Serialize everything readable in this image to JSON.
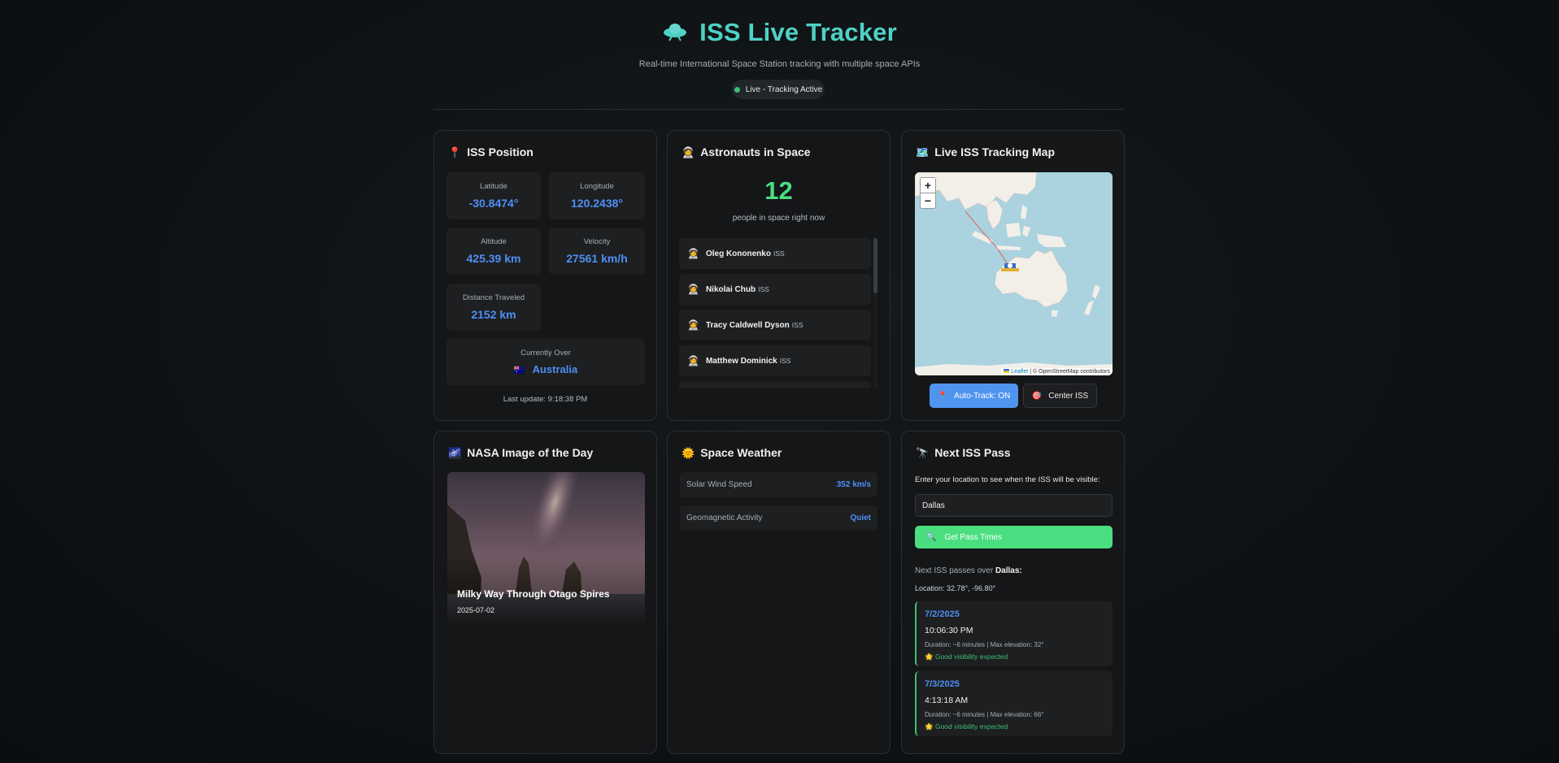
{
  "header": {
    "title": "ISS Live Tracker",
    "subtitle": "Real-time International Space Station tracking with multiple space APIs",
    "status": "Live - Tracking Active",
    "icon": "flying-saucer-icon"
  },
  "position": {
    "title": "ISS Position",
    "icon": "pin-icon",
    "latitude_label": "Latitude",
    "latitude": "-30.8474°",
    "longitude_label": "Longitude",
    "longitude": "120.2438°",
    "altitude_label": "Altitude",
    "altitude": "425.39 km",
    "velocity_label": "Velocity",
    "velocity": "27561 km/h",
    "distance_label": "Distance Traveled",
    "distance": "2152 km",
    "over_label": "Currently Over",
    "over_flag": "🇦🇺",
    "over": "Australia",
    "last_update": "Last update: 9:18:38 PM"
  },
  "astronauts": {
    "title": "Astronauts in Space",
    "icon": "astronaut-icon",
    "count": "12",
    "count_label": "people in space right now",
    "people": [
      {
        "name": "Oleg Kononenko",
        "craft": "ISS"
      },
      {
        "name": "Nikolai Chub",
        "craft": "ISS"
      },
      {
        "name": "Tracy Caldwell Dyson",
        "craft": "ISS"
      },
      {
        "name": "Matthew Dominick",
        "craft": "ISS"
      }
    ]
  },
  "map": {
    "title": "Live ISS Tracking Map",
    "icon": "map-icon",
    "zoom_in": "+",
    "zoom_out": "−",
    "attribution_link": "Leaflet",
    "attribution_text": "| © OpenStreetMap contributors",
    "autotrack_label": "Auto-Track: ON",
    "center_label": "Center ISS"
  },
  "nasa": {
    "title": "NASA Image of the Day",
    "icon": "galaxy-icon",
    "image_title": "Milky Way Through Otago Spires",
    "image_date": "2025-07-02"
  },
  "weather": {
    "title": "Space Weather",
    "icon": "sun-icon",
    "rows": [
      {
        "label": "Solar Wind Speed",
        "value": "352 km/s"
      },
      {
        "label": "Geomagnetic Activity",
        "value": "Quiet"
      }
    ]
  },
  "pass": {
    "title": "Next ISS Pass",
    "icon": "telescope-icon",
    "prompt": "Enter your location to see when the ISS will be visible:",
    "location_value": "Dallas",
    "button_label": "Get Pass Times",
    "result_prefix": "Next ISS passes over",
    "result_city": "Dallas:",
    "location_coords": "Location: 32.78°, -96.80°",
    "passes": [
      {
        "date": "7/2/2025",
        "time": "10:06:30 PM",
        "info": "Duration: ~6 minutes | Max elevation: 32°",
        "visibility": "Good visibility expected"
      },
      {
        "date": "7/3/2025",
        "time": "4:13:18 AM",
        "info": "Duration: ~6 minutes | Max elevation: 66°",
        "visibility": "Good visibility expected"
      }
    ]
  },
  "colors": {
    "accent_teal": "#4fd1c5",
    "value_blue": "#4f8ff5",
    "live_green": "#3fbf75",
    "button_green": "#4ade80"
  }
}
